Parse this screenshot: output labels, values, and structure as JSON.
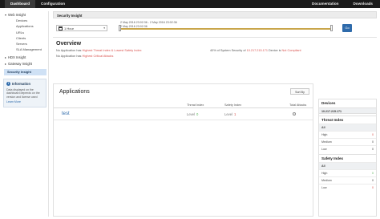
{
  "topnav": {
    "tabs": [
      "Dashboard",
      "Configuration"
    ],
    "right_links": [
      "Documentation",
      "Downloads"
    ]
  },
  "sidebar": {
    "web_insight": "Web Insight",
    "web_items": [
      "Devices",
      "Applications",
      "URLs",
      "Clients",
      "Servers",
      "SLA Management"
    ],
    "hdx_insight": "HDX Insight",
    "gateway_insight": "Gateway Insight",
    "security_insight": "Security Insight",
    "info": {
      "title": "Information",
      "text": "Data displayed on the dashboard depends on the version and license used",
      "link": "Learn More"
    }
  },
  "main": {
    "panel_title": "Security Insight",
    "time_select": "1 Hour",
    "range_start": "2 May 2016 23:02:36 - 2 May 2016 23:02:36",
    "range_end": "2 May 2016 23:02:36",
    "go_label": "Go",
    "overview": {
      "title": "Overview",
      "line1_prefix": "No Application has ",
      "line1_red": "Highest Threat Index & Lowest Safety Index",
      "line2_prefix": "No Application has ",
      "line2_red": "Highest Critical Attacks",
      "line3_prefix": "40% of System Security of ",
      "line3_red_ip": "10.217.215.171",
      "line3_mid": " Device is ",
      "line3_red_status": "Not Compliant"
    },
    "applications": {
      "title": "Applications",
      "sort_label": "Sort By",
      "headers": [
        "Threat Index",
        "Safety Index",
        "Total Attacks"
      ],
      "rows": [
        {
          "name": "test",
          "threat_label": "Level",
          "threat_value": "0",
          "safety_label": "Level",
          "safety_value": "1"
        }
      ]
    }
  },
  "right_panel": {
    "devices_title": "Devices",
    "device_ip": "10.217.215.171",
    "threat_title": "Threat Index",
    "threat_rows": [
      {
        "label": "All",
        "count": ""
      },
      {
        "label": "High",
        "count": "0"
      },
      {
        "label": "Medium",
        "count": "0"
      },
      {
        "label": "Low",
        "count": "0"
      }
    ],
    "safety_title": "Safety Index",
    "safety_rows": [
      {
        "label": "All",
        "count": ""
      },
      {
        "label": "High",
        "count": "0"
      },
      {
        "label": "Medium",
        "count": "0"
      },
      {
        "label": "Low",
        "count": "0"
      }
    ]
  },
  "colors": {
    "accent": "#2f6bab",
    "danger": "#d9534f",
    "topbar": "#1b1b1b",
    "slider": "#c9a64a"
  }
}
